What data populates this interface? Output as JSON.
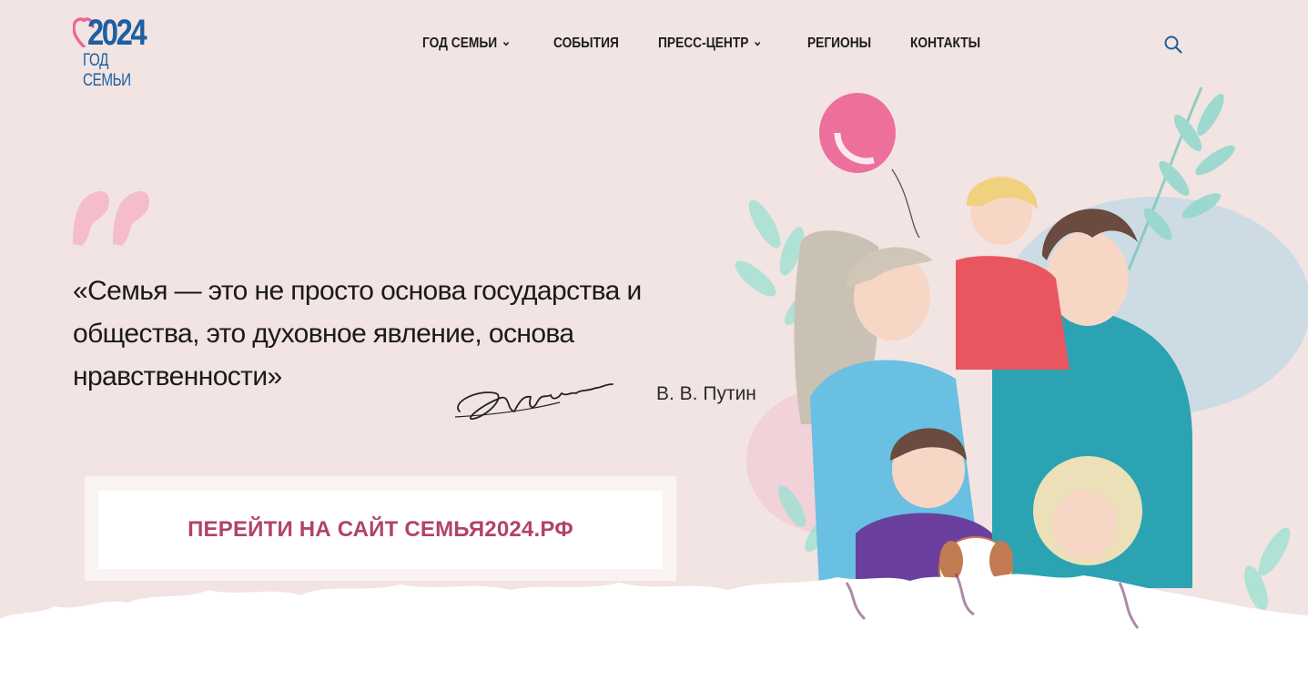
{
  "header": {
    "logo": {
      "year": "2024",
      "subtitle": "ГОД СЕМЬИ",
      "heart_color": "#e9699b",
      "text_color": "#1e5fa0"
    },
    "nav": [
      {
        "label": "ГОД СЕМЬИ",
        "has_dropdown": true
      },
      {
        "label": "СОБЫТИЯ",
        "has_dropdown": false
      },
      {
        "label": "ПРЕСС-ЦЕНТР",
        "has_dropdown": true
      },
      {
        "label": "РЕГИОНЫ",
        "has_dropdown": false
      },
      {
        "label": "КОНТАКТЫ",
        "has_dropdown": false
      }
    ],
    "search_icon": "search-icon"
  },
  "hero": {
    "quote": "«Семья — это не просто основа государства и общества, это духовное явление, основа нравственности»",
    "author": "В. В. Путин",
    "quote_mark_color": "#f5bccb",
    "cta": {
      "label": "ПЕРЕЙТИ НА САЙТ СЕМЬЯ2024.РФ",
      "color": "#b24463"
    }
  },
  "colors": {
    "background": "#f2e4e2",
    "accent": "#1e5fa0"
  }
}
